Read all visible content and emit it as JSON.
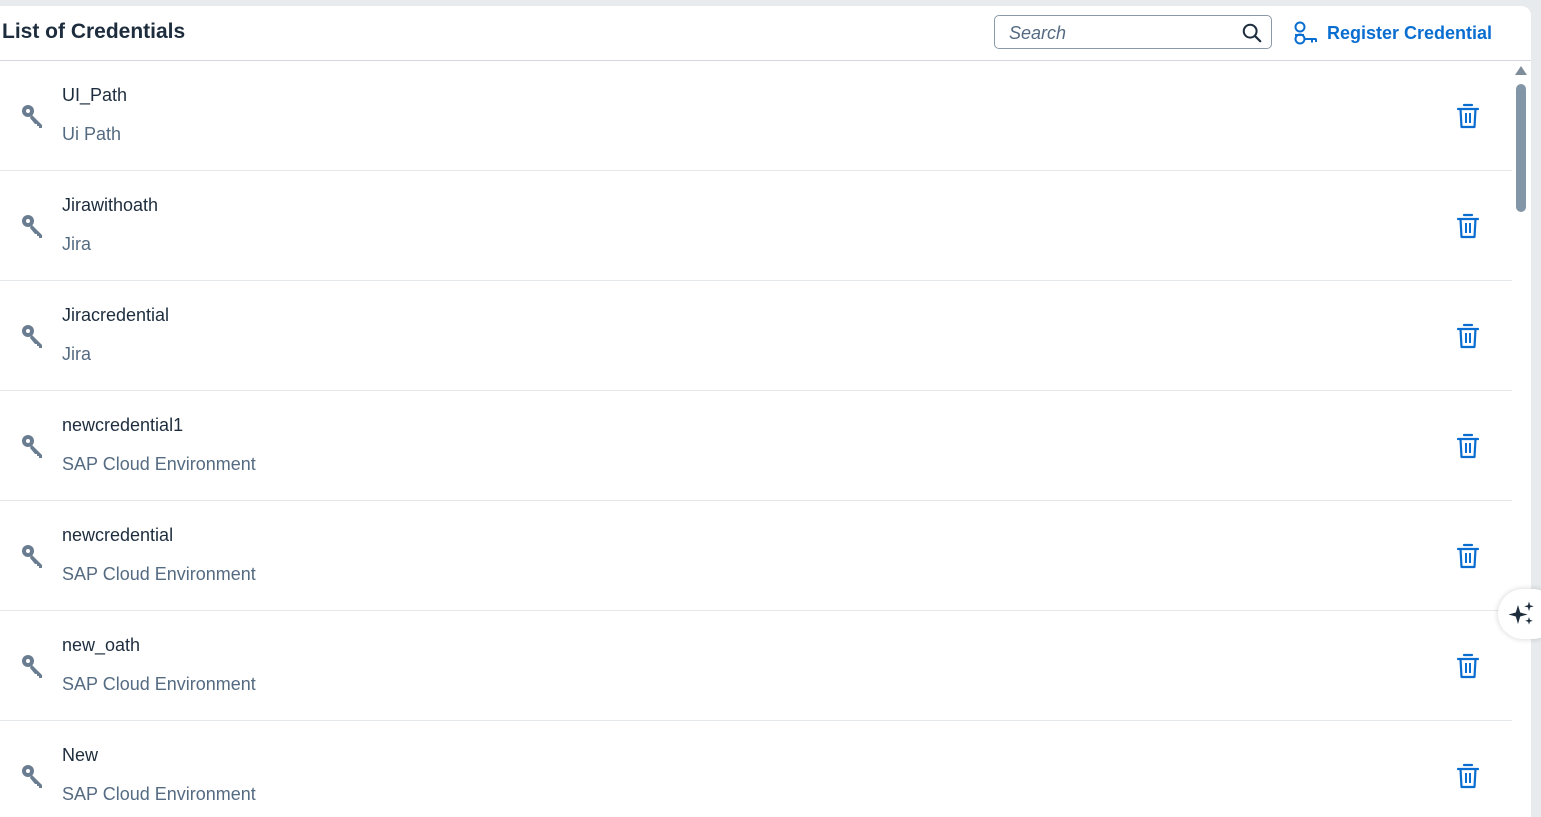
{
  "header": {
    "title": "List of Credentials",
    "search_placeholder": "Search",
    "register_label": "Register Credential"
  },
  "colors": {
    "accent": "#0a6ed1",
    "title": "#1d2d3e",
    "secondary_text": "#556b82",
    "key_icon": "#6a7d90"
  },
  "credentials": [
    {
      "name": "UI_Path",
      "type": "Ui Path",
      "icon": "key-icon",
      "action_icon": "trash-icon"
    },
    {
      "name": "Jirawithoath",
      "type": "Jira",
      "icon": "key-icon",
      "action_icon": "trash-icon"
    },
    {
      "name": "Jiracredential",
      "type": "Jira",
      "icon": "key-icon",
      "action_icon": "trash-icon"
    },
    {
      "name": "newcredential1",
      "type": "SAP Cloud Environment",
      "icon": "key-icon",
      "action_icon": "trash-icon"
    },
    {
      "name": "newcredential",
      "type": "SAP Cloud Environment",
      "icon": "key-icon",
      "action_icon": "trash-icon"
    },
    {
      "name": "new_oath",
      "type": "SAP Cloud Environment",
      "icon": "key-icon",
      "action_icon": "trash-icon"
    },
    {
      "name": "New",
      "type": "SAP Cloud Environment",
      "icon": "key-icon",
      "action_icon": "trash-icon"
    }
  ],
  "floating": {
    "icon": "sparkle-ai-icon"
  }
}
